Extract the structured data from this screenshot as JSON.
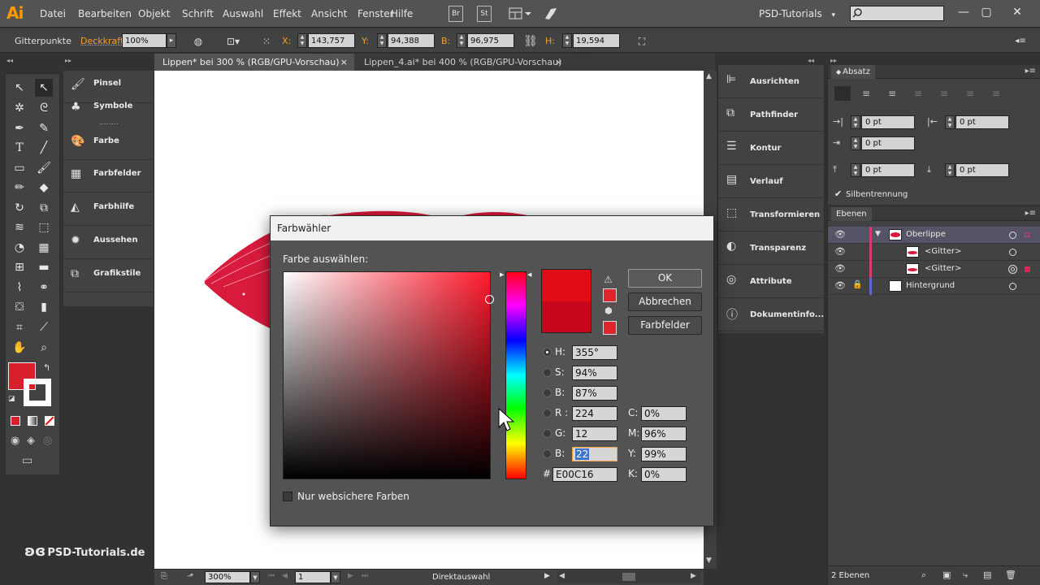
{
  "app": {
    "logo": "Ai",
    "menu": [
      "Datei",
      "Bearbeiten",
      "Objekt",
      "Schrift",
      "Auswahl",
      "Effekt",
      "Ansicht",
      "Fenster",
      "Hilfe"
    ],
    "bridge": "Br",
    "stock": "St",
    "workspace": "PSD-Tutorials",
    "workspace_arrow": "▾",
    "window_controls": [
      "—",
      "▢",
      "✕"
    ]
  },
  "control_bar": {
    "selection_label": "Gitterpunkte",
    "opacity_label": "Deckkraft:",
    "opacity_value": "100%",
    "x_label": "X:",
    "x_value": "143,757 mm",
    "y_label": "Y:",
    "y_value": "94,388 mm",
    "w_label": "B:",
    "w_value": "96,975 mm",
    "h_label": "H:",
    "h_value": "19,594 mm"
  },
  "tabs": [
    {
      "label": "Lippen* bei 300 % (RGB/GPU-Vorschau)",
      "close": "×"
    },
    {
      "label": "Lippen_4.ai* bei 400 % (RGB/GPU-Vorschau)",
      "close": "×"
    }
  ],
  "left_dock": [
    "Pinsel",
    "Symbole",
    "Farbe",
    "Farbfelder",
    "Farbhilfe",
    "Aussehen",
    "Grafikstile"
  ],
  "right_dock": [
    "Ausrichten",
    "Pathfinder",
    "Kontur",
    "Verlauf",
    "Transformieren",
    "Transparenz",
    "Attribute",
    "Dokumentinfo..."
  ],
  "absatz": {
    "title": "Absatz",
    "fields": [
      "0 pt",
      "0 pt",
      "0 pt",
      "0 pt",
      "0 pt"
    ],
    "hyphen_label": "Silbentrennung",
    "hyphen_check": "✔"
  },
  "ebenen": {
    "title": "Ebenen",
    "layers": [
      {
        "name": "Oberlippe"
      },
      {
        "name": "<Gitter>"
      },
      {
        "name": "<Gitter>"
      },
      {
        "name": "Hintergrund"
      }
    ],
    "count": "2 Ebenen"
  },
  "status": {
    "zoom": "300%",
    "page": "1",
    "tool": "Direktauswahl"
  },
  "dialog": {
    "title": "Farbwähler",
    "subtitle": "Farbe auswählen:",
    "buttons": {
      "ok": "OK",
      "cancel": "Abbrechen",
      "swatches": "Farbfelder"
    },
    "hsb": [
      {
        "label": "H:",
        "value": "355°"
      },
      {
        "label": "S:",
        "value": "94%"
      },
      {
        "label": "B:",
        "value": "87%"
      }
    ],
    "rgb": [
      {
        "label": "R :",
        "value": "224"
      },
      {
        "label": "G:",
        "value": "12"
      },
      {
        "label": "B:",
        "value": "22"
      }
    ],
    "cmyk": [
      {
        "label": "C:",
        "value": "0%"
      },
      {
        "label": "M:",
        "value": "96%"
      },
      {
        "label": "Y:",
        "value": "99%"
      },
      {
        "label": "K:",
        "value": "0%"
      }
    ],
    "hex_label": "#",
    "hex_value": "E00C16",
    "websafe_label": "Nur websichere Farben",
    "new_color": "#e00c16",
    "old_color": "#c7081c"
  },
  "watermark": "PSD-Tutorials.de"
}
